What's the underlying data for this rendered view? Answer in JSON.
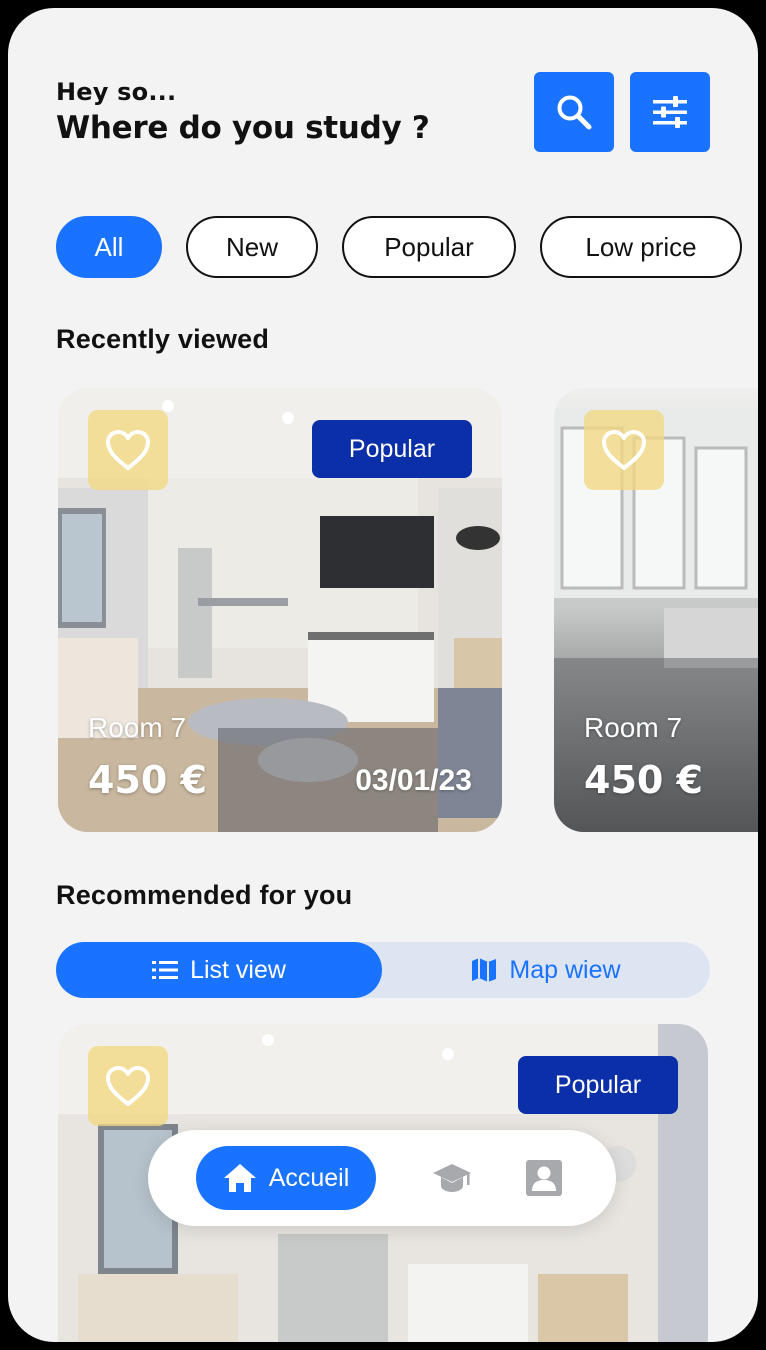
{
  "header": {
    "greeting": "Hey so...",
    "question": "Where do you study ?"
  },
  "filters": [
    {
      "label": "All",
      "active": true
    },
    {
      "label": "New",
      "active": false
    },
    {
      "label": "Popular",
      "active": false
    },
    {
      "label": "Low price",
      "active": false
    }
  ],
  "recently_viewed": {
    "title": "Recently viewed",
    "cards": [
      {
        "badge": "Popular",
        "name": "Room 7",
        "price": "450 €",
        "date": "03/01/23"
      },
      {
        "name": "Room 7",
        "price": "450 €"
      }
    ]
  },
  "recommended": {
    "title": "Recommended for you",
    "list_view_label": "List view",
    "map_view_label": "Map wiew",
    "card": {
      "badge": "Popular"
    }
  },
  "bottom_nav": {
    "home_label": "Accueil"
  },
  "colors": {
    "accent": "#1a73ff",
    "badge": "#0a2fa8",
    "favorite_bg": "#f2d882",
    "background": "#f3f3f4"
  },
  "icons": [
    "search-icon",
    "filter-sliders-icon",
    "heart-icon",
    "list-icon",
    "map-icon",
    "home-icon",
    "graduation-cap-icon",
    "profile-icon"
  ]
}
